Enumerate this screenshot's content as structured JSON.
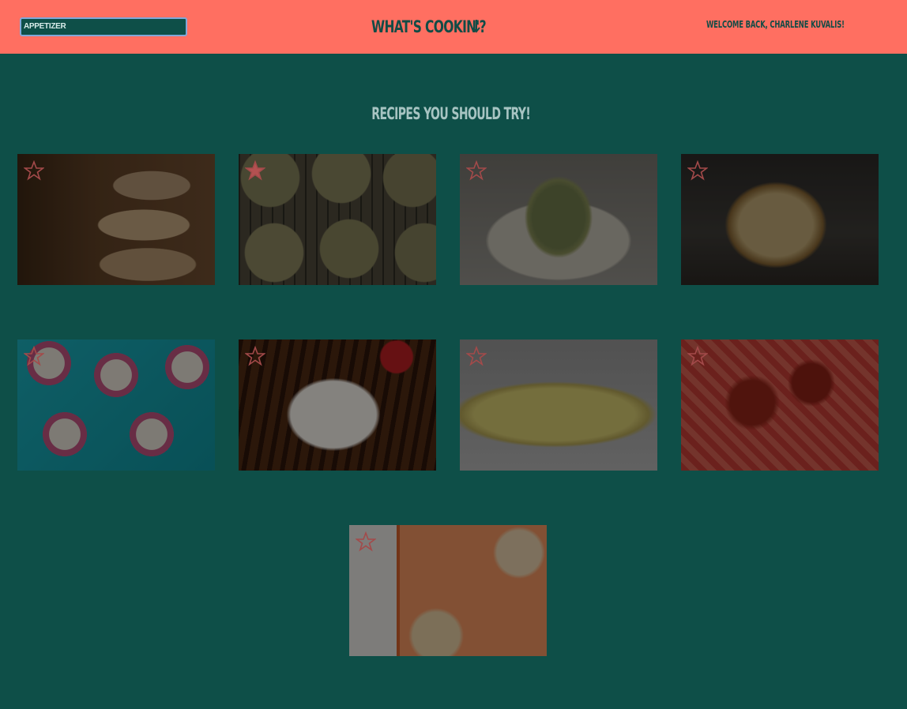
{
  "header": {
    "search": {
      "value": "APPETIZER"
    },
    "site_title": "WHAT'S COOKIN'?",
    "arrow_icon": "arrow-down-icon",
    "welcome": "WELCOME BACK, CHARLENE KUVALIS!"
  },
  "main": {
    "heading": "RECIPES YOU SHOULD TRY!",
    "recipes": [
      {
        "image": "stacked-cookies",
        "favorited": false
      },
      {
        "image": "cookies-on-cooling-rack",
        "favorited": true
      },
      {
        "image": "stuffed-artichoke",
        "favorited": false
      },
      {
        "image": "loaf-of-bread",
        "favorited": false
      },
      {
        "image": "frosted-cupcakes-with-sprinkles",
        "favorited": false
      },
      {
        "image": "ice-cream-pie-with-chocolate-sauce",
        "favorited": false
      },
      {
        "image": "vegetable-pizza-slice",
        "favorited": false
      },
      {
        "image": "meatballs-and-spaghetti",
        "favorited": false
      },
      {
        "image": "candy-cookies-on-baking-sheet",
        "favorited": false
      }
    ]
  },
  "colors": {
    "header_bg": "#ff6f61",
    "page_bg": "#0e4f48",
    "star_outline": "#a34a4a",
    "star_fill_active": "#b35151"
  }
}
